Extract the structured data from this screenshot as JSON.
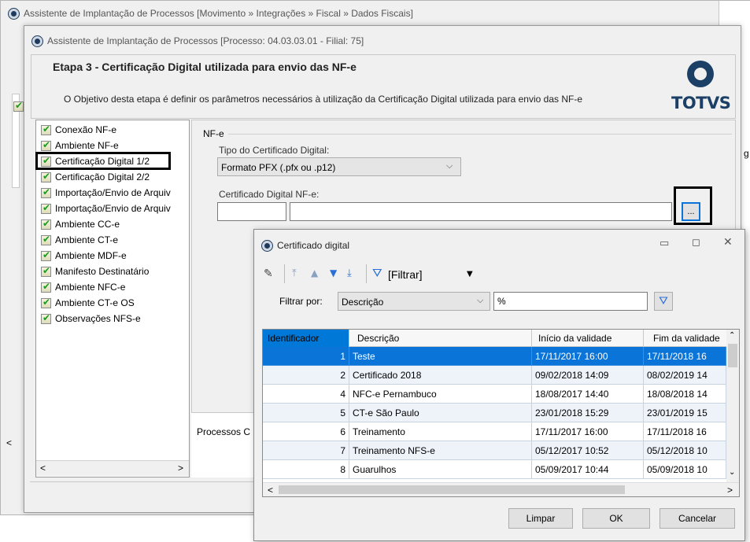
{
  "outer_window": {
    "title": "Assistente de Implantação de Processos [Movimento » Integrações » Fiscal » Dados Fiscais]",
    "right_label": "g"
  },
  "wizard": {
    "title": "Assistente de Implantação de Processos [Processo: 04.03.03.01 - Filial: 75]",
    "step_heading": "Etapa 3 - Certificação Digital utilizada para envio das NF-e",
    "step_description": "O Objetivo desta etapa é definir os parâmetros necessários à utilização da Certificação Digital utilizada para envio das NF-e",
    "logo_text": "TOTVS",
    "steps": [
      "Conexão NF-e",
      "Ambiente NF-e",
      "Certificação Digital 1/2",
      "Certificação Digital 2/2",
      "Importação/Envio de Arquiv",
      "Importação/Envio de Arquiv",
      "Ambiente CC-e",
      "Ambiente CT-e",
      "Ambiente MDF-e",
      "Manifesto Destinatário",
      "Ambiente NFC-e",
      "Ambiente CT-e OS",
      "Observações NFS-e"
    ],
    "selected_step_index": 2,
    "group_label": "NF-e",
    "cert_type_label": "Tipo do Certificado Digital:",
    "cert_type_value": "Formato PFX (.pfx ou .p12)",
    "cert_field_label": "Certificado Digital NF-e:",
    "cert_code_value": "",
    "cert_name_value": "",
    "browse_button": "...",
    "bottom_tab": "Processos C",
    "scroll_left": "<",
    "scroll_right": ">"
  },
  "dialog": {
    "title": "Certificado digital",
    "filter_menu": "[Filtrar]",
    "filter_by_label": "Filtrar por:",
    "filter_by_value": "Descrição",
    "filter_text": "%",
    "columns": [
      "Identificador",
      "Descrição",
      "Início da validade",
      "Fim da validade"
    ],
    "rows": [
      {
        "id": "1",
        "desc": "Teste",
        "start": "17/11/2017 16:00",
        "end": "17/11/2018 16"
      },
      {
        "id": "2",
        "desc": "Certificado 2018",
        "start": "09/02/2018 14:09",
        "end": "08/02/2019 14"
      },
      {
        "id": "4",
        "desc": "NFC-e Pernambuco",
        "start": "18/08/2017 14:40",
        "end": "18/08/2018 14"
      },
      {
        "id": "5",
        "desc": "CT-e São Paulo",
        "start": "23/01/2018 15:29",
        "end": "23/01/2019 15"
      },
      {
        "id": "6",
        "desc": "Treinamento",
        "start": "17/11/2017 16:00",
        "end": "17/11/2018 16"
      },
      {
        "id": "7",
        "desc": "Treinamento NFS-e",
        "start": "05/12/2017 10:52",
        "end": "05/12/2018 10"
      },
      {
        "id": "8",
        "desc": "Guarulhos",
        "start": "05/09/2017 10:44",
        "end": "05/09/2018 10"
      }
    ],
    "selected_row_index": 0,
    "buttons": {
      "clear": "Limpar",
      "ok": "OK",
      "cancel": "Cancelar"
    }
  },
  "colors": {
    "selection": "#0a74d8",
    "header_highlight": "#0078d7",
    "totvs_blue": "#1c3f66",
    "highlight_box": "#000000"
  }
}
